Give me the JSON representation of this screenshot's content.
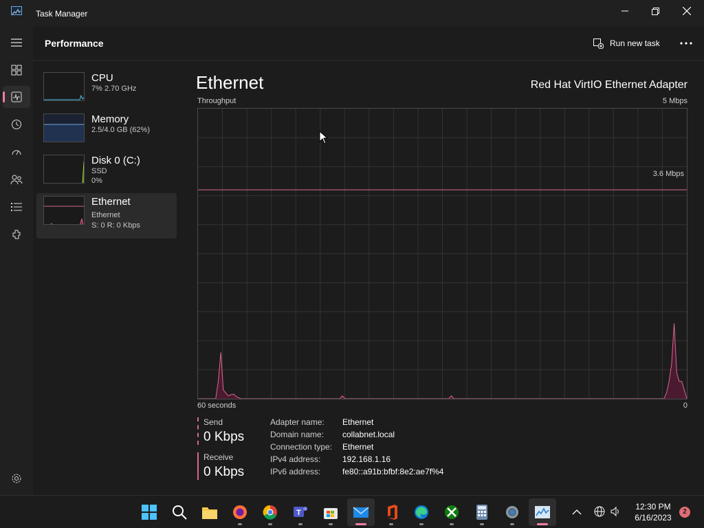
{
  "window": {
    "title": "Task Manager"
  },
  "header": {
    "page_title": "Performance",
    "run_new_task_label": "Run new task"
  },
  "nav": {
    "items": [
      {
        "name": "menu",
        "icon": "hamburger-icon"
      },
      {
        "name": "processes",
        "icon": "processes-icon"
      },
      {
        "name": "performance",
        "icon": "performance-icon",
        "active": true
      },
      {
        "name": "app-history",
        "icon": "history-icon"
      },
      {
        "name": "startup-apps",
        "icon": "startup-icon"
      },
      {
        "name": "users",
        "icon": "users-icon"
      },
      {
        "name": "details",
        "icon": "details-icon"
      },
      {
        "name": "services",
        "icon": "services-icon"
      },
      {
        "name": "settings",
        "icon": "settings-gear-icon"
      }
    ]
  },
  "resources": [
    {
      "name": "CPU",
      "line1": "7% 2.70 GHz",
      "line2": ""
    },
    {
      "name": "Memory",
      "line1": "2.5/4.0 GB (62%)",
      "line2": ""
    },
    {
      "name": "Disk 0 (C:)",
      "line1": "SSD",
      "line2": "0%"
    },
    {
      "name": "Ethernet",
      "line1": "Ethernet",
      "line2": "S: 0 R: 0 Kbps",
      "active": true
    }
  ],
  "detail": {
    "title": "Ethernet",
    "adapter": "Red Hat VirtIO Ethernet Adapter",
    "throughput_label": "Throughput",
    "max_label": "5 Mbps",
    "scale_label": "3.6 Mbps",
    "time_label": "60 seconds",
    "zero_label": "0",
    "send_label": "Send",
    "send_value": "0 Kbps",
    "receive_label": "Receive",
    "receive_value": "0 Kbps",
    "properties": [
      {
        "key": "Adapter name:",
        "value": "Ethernet"
      },
      {
        "key": "Domain name:",
        "value": "collabnet.local"
      },
      {
        "key": "Connection type:",
        "value": "Ethernet"
      },
      {
        "key": "IPv4 address:",
        "value": "192.168.1.16"
      },
      {
        "key": "IPv6 address:",
        "value": "fe80::a91b:bfbf:8e2:ae7f%4"
      }
    ]
  },
  "throughput_graph": {
    "x_range_seconds": [
      60,
      0
    ],
    "y_range_mbps": [
      0,
      5
    ],
    "scale_line_mbps": 3.6,
    "samples_mbps": [
      0,
      0,
      0,
      0,
      0,
      0,
      0,
      0,
      0.3,
      0.8,
      0.15,
      0.1,
      0.05,
      0.07,
      0.08,
      0.04,
      0.02,
      0,
      0,
      0,
      0,
      0,
      0,
      0,
      0,
      0,
      0,
      0,
      0,
      0,
      0,
      0,
      0,
      0,
      0,
      0,
      0,
      0,
      0,
      0,
      0,
      0,
      0,
      0,
      0,
      0,
      0,
      0,
      0,
      0,
      0,
      0,
      0,
      0,
      0,
      0,
      0,
      0.05,
      0,
      0,
      0,
      0,
      0,
      0,
      0,
      0,
      0,
      0,
      0,
      0,
      0,
      0,
      0,
      0,
      0,
      0,
      0,
      0,
      0,
      0,
      0,
      0,
      0,
      0,
      0,
      0,
      0,
      0,
      0,
      0,
      0,
      0,
      0,
      0,
      0,
      0,
      0,
      0,
      0,
      0,
      0.05,
      0,
      0,
      0,
      0,
      0,
      0,
      0,
      0,
      0,
      0,
      0,
      0,
      0,
      0,
      0,
      0,
      0,
      0,
      0,
      0,
      0,
      0,
      0,
      0,
      0,
      0,
      0,
      0,
      0,
      0,
      0,
      0,
      0,
      0,
      0,
      0,
      0,
      0,
      0,
      0,
      0,
      0,
      0,
      0,
      0,
      0,
      0,
      0,
      0,
      0,
      0,
      0,
      0,
      0,
      0,
      0,
      0,
      0,
      0,
      0,
      0,
      0,
      0,
      0,
      0,
      0,
      0,
      0,
      0,
      0,
      0,
      0,
      0,
      0,
      0,
      0,
      0,
      0,
      0,
      0,
      0,
      0,
      0,
      0,
      0.1,
      0.3,
      0.6,
      1.3,
      0.45,
      0.3,
      0.3,
      0.15,
      0
    ],
    "series_colors": {
      "line": "#d9678f",
      "fill": "#4a1a30",
      "grid": "#333333",
      "scale": "#d9678f"
    }
  },
  "taskbar": {
    "apps": [
      {
        "name": "start-button",
        "icon": "windows-logo-icon"
      },
      {
        "name": "search-button",
        "icon": "search-icon"
      },
      {
        "name": "file-explorer",
        "icon": "folder-icon"
      },
      {
        "name": "firefox",
        "icon": "firefox-icon"
      },
      {
        "name": "chrome",
        "icon": "chrome-icon"
      },
      {
        "name": "teams",
        "icon": "teams-icon"
      },
      {
        "name": "store",
        "icon": "store-icon"
      },
      {
        "name": "mail",
        "icon": "mail-icon"
      },
      {
        "name": "office",
        "icon": "office-icon"
      },
      {
        "name": "edge",
        "icon": "edge-icon"
      },
      {
        "name": "xbox",
        "icon": "xbox-icon"
      },
      {
        "name": "calculator",
        "icon": "calculator-icon"
      },
      {
        "name": "settings",
        "icon": "settings-icon"
      },
      {
        "name": "task-manager",
        "icon": "task-manager-icon"
      }
    ],
    "time": "12:30 PM",
    "date": "6/16/2023",
    "notification_count": "2"
  }
}
